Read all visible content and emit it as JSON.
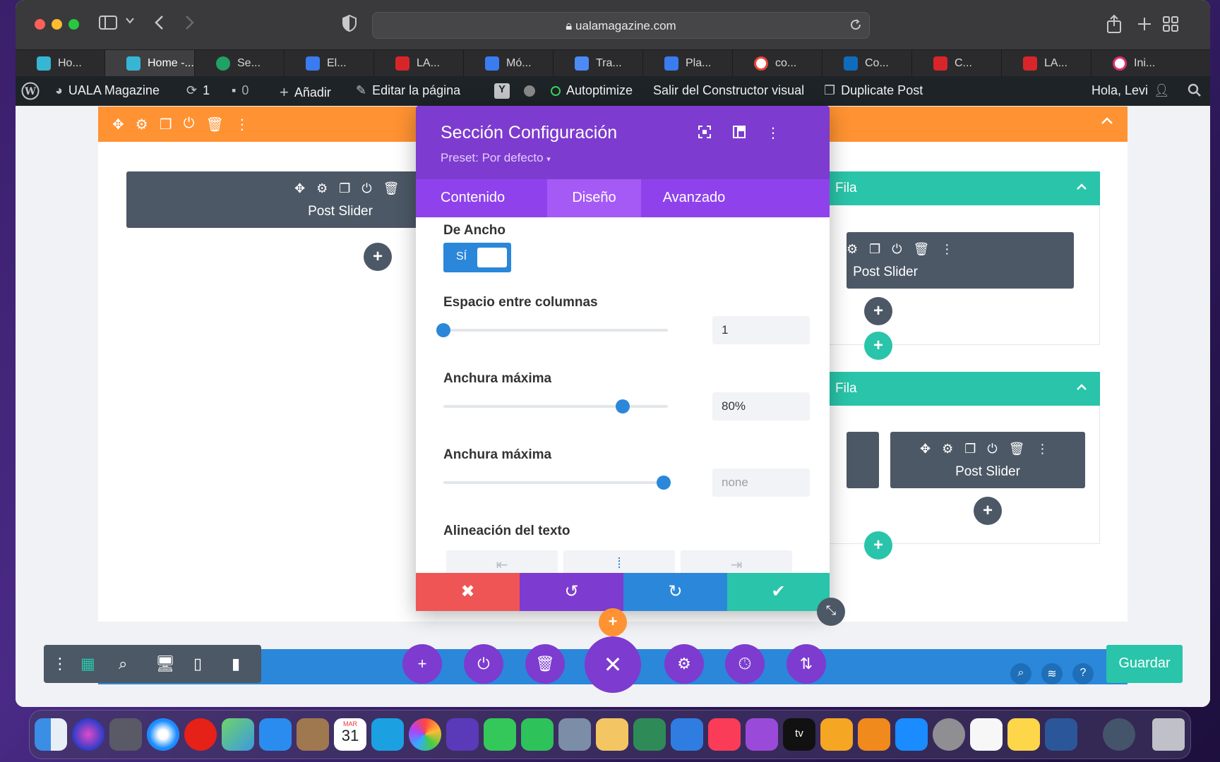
{
  "browser": {
    "url": "ualamagazine.com",
    "tabs": [
      {
        "label": "Ho...",
        "color": "#37b6d4"
      },
      {
        "label": "Home -...",
        "color": "#37b6d4"
      },
      {
        "label": "Se...",
        "color": "#20a165"
      },
      {
        "label": "El...",
        "color": "#3b7bf0"
      },
      {
        "label": "LA...",
        "color": "#d8252a"
      },
      {
        "label": "Mó...",
        "color": "#3b7bf0"
      },
      {
        "label": "Tra...",
        "color": "#4c8bf5"
      },
      {
        "label": "Pla...",
        "color": "#3b7bf0"
      },
      {
        "label": "co...",
        "color": "#ffffff"
      },
      {
        "label": "Co...",
        "color": "#0f6cbd"
      },
      {
        "label": "C...",
        "color": "#d8252a"
      },
      {
        "label": "LA...",
        "color": "#d8252a"
      },
      {
        "label": "Ini...",
        "color": "#e1306c"
      }
    ]
  },
  "wp_admin_bar": {
    "site_name": "UALA Magazine",
    "updates_count": "1",
    "comments_count": "0",
    "add_new": "Añadir",
    "edit_page": "Editar la página",
    "autoptimize": "Autoptimize",
    "exit_builder": "Salir del Constructor visual",
    "duplicate_post": "Duplicate Post",
    "greeting": "Hola, Levi"
  },
  "builder": {
    "module_left_title": "Post Slider",
    "row1_title": "Fila",
    "row1_module_title": "Post Slider",
    "row2_title": "Fila",
    "row2_module_title": "Post Slider",
    "save_label": "Guardar"
  },
  "modal": {
    "title": "Sección Configuración",
    "preset": "Preset: Por defecto",
    "tabs": [
      "Contenido",
      "Diseño",
      "Avanzado"
    ],
    "active_tab": "Diseño",
    "fields": {
      "full_width_label": "De Ancho",
      "full_width_toggle": "SÍ",
      "gutter_label": "Espacio entre columnas",
      "gutter_value": "1",
      "gutter_level": 0.0,
      "max_width_label": "Anchura máxima",
      "max_width_value": "80%",
      "max_width_level": 0.8,
      "max_width2_label": "Anchura máxima",
      "max_width2_placeholder": "none",
      "max_width2_level": 0.98,
      "text_align_label": "Alineación del texto"
    }
  },
  "colors": {
    "orange": "#ff9232",
    "purple": "#7d3bcf",
    "teal": "#29c4a9",
    "blue": "#2b87da",
    "red": "#ef5555"
  },
  "dock": {
    "calendar_month": "MAR",
    "calendar_day": "31",
    "tv_label": "tv"
  }
}
